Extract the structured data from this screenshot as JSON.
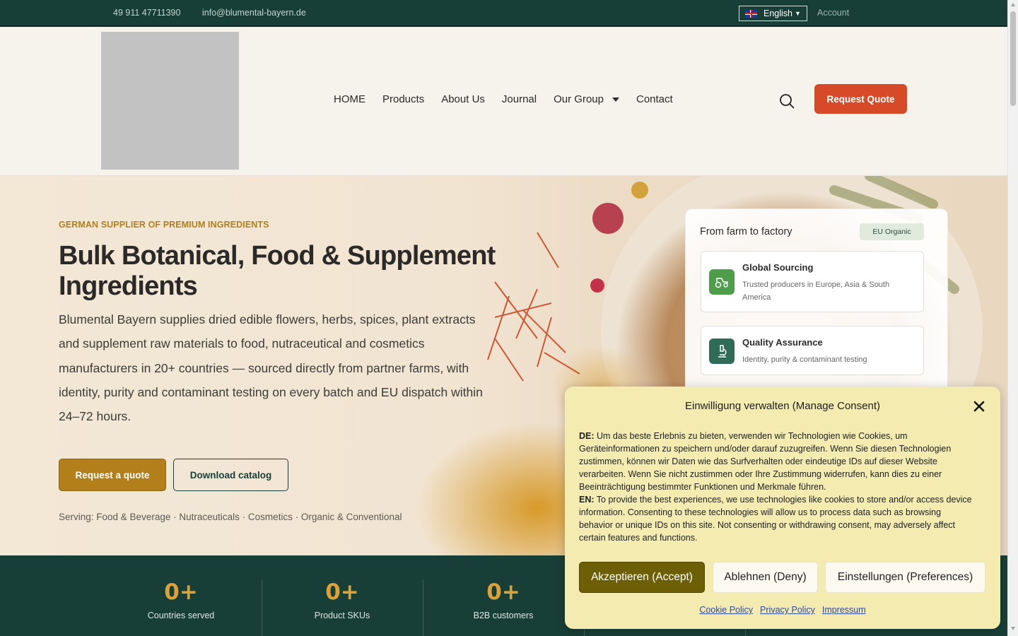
{
  "topbar": {
    "phone": "49 911 47711390",
    "email": "info@blumental-bayern.de",
    "language": "English",
    "account": "Account"
  },
  "header": {
    "nav": [
      "HOME",
      "Products",
      "About Us",
      "Journal",
      "Our Group",
      "Contact"
    ],
    "cta": "Request Quote",
    "search_icon": "search-icon"
  },
  "hero": {
    "eyebrow": "GERMAN SUPPLIER OF PREMIUM INGREDIENTS",
    "title": "Bulk Botanical, Food & Supplement Ingredients",
    "description": "Blumental Bayern supplies dried edible flowers, herbs, spices, plant extracts and supplement raw materials to food, nutraceutical and cosmetics manufacturers in 20+ countries — sourced directly from partner farms, with identity, purity and contaminant testing on every batch and EU dispatch within 24–72 hours.",
    "primary_button": "Request a quote",
    "secondary_button": "Download catalog",
    "serving": "Serving: Food & Beverage · Nutraceuticals · Cosmetics · Organic & Conventional"
  },
  "card": {
    "title": "From farm to factory",
    "badge": "EU Organic",
    "features": [
      {
        "title": "Global Sourcing",
        "subtitle": "Trusted producers in Europe, Asia & South America",
        "icon": "tractor-icon",
        "icon_color": "#4f9d4a"
      },
      {
        "title": "Quality Assurance",
        "subtitle": "Identity, purity & contaminant testing",
        "icon": "microscope-icon",
        "icon_color": "#2f6b56"
      }
    ]
  },
  "stats": [
    {
      "value": "0+",
      "label": "Countries served"
    },
    {
      "value": "0+",
      "label": "Product SKUs"
    },
    {
      "value": "0+",
      "label": "B2B customers"
    }
  ],
  "consent": {
    "title": "Einwilligung verwalten (Manage Consent)",
    "de_label": "DE:",
    "de_text": "Um das beste Erlebnis zu bieten, verwenden wir Technologien wie Cookies, um Geräteinformationen zu speichern und/oder darauf zuzugreifen. Wenn Sie diesen Technologien zustimmen, können wir Daten wie das Surfverhalten oder eindeutige IDs auf dieser Website verarbeiten. Wenn Sie nicht zustimmen oder Ihre Zustimmung widerrufen, kann dies zu einer Beeinträchtigung bestimmter Funktionen und Merkmale führen.",
    "en_label": "EN:",
    "en_text": "To provide the best experiences, we use technologies like cookies to store and/or access device information. Consenting to these technologies will allow us to process data such as browsing behavior or unique IDs on this site. Not consenting or withdrawing consent, may adversely affect certain features and functions.",
    "accept": "Akzeptieren (Accept)",
    "deny": "Ablehnen (Deny)",
    "preferences": "Einstellungen (Preferences)",
    "links": [
      "Cookie Policy",
      "Privacy Policy",
      "Impressum"
    ]
  },
  "colors": {
    "dark_green": "#183f37",
    "accent_orange": "#d64a27",
    "gold": "#b27f1b",
    "consent_bg": "#f4ebb0",
    "accept_btn": "#6c5f06"
  }
}
